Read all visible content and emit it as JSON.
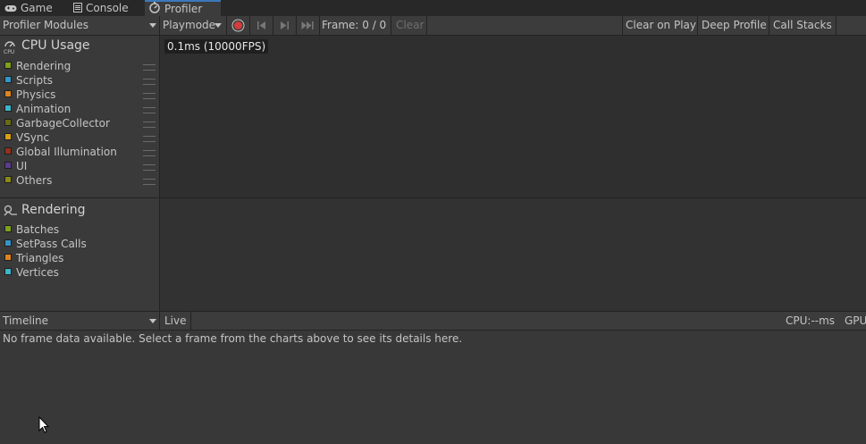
{
  "tabs": [
    {
      "label": "Game",
      "icon": "gamepad-icon"
    },
    {
      "label": "Console",
      "icon": "console-icon"
    },
    {
      "label": "Profiler",
      "icon": "profiler-icon",
      "active": true
    }
  ],
  "toolbar": {
    "modules_dropdown": "Profiler Modules",
    "playmode": "Playmode",
    "frame": "Frame: 0 / 0",
    "clear": "Clear",
    "clear_on_play": "Clear on Play",
    "deep_profile": "Deep Profile",
    "call_stacks": "Call Stacks"
  },
  "cpu_module": {
    "title": "CPU Usage",
    "items": [
      {
        "label": "Rendering",
        "color": "#7ea21a"
      },
      {
        "label": "Scripts",
        "color": "#3496c8"
      },
      {
        "label": "Physics",
        "color": "#e0831c"
      },
      {
        "label": "Animation",
        "color": "#3bb6c8"
      },
      {
        "label": "GarbageCollector",
        "color": "#6a6a14"
      },
      {
        "label": "VSync",
        "color": "#d8a014"
      },
      {
        "label": "Global Illumination",
        "color": "#96301c"
      },
      {
        "label": "UI",
        "color": "#5a3c8c"
      },
      {
        "label": "Others",
        "color": "#8a8a14"
      }
    ],
    "tooltip": "0.1ms (10000FPS)"
  },
  "rendering_module": {
    "title": "Rendering",
    "items": [
      {
        "label": "Batches",
        "color": "#7ea21a"
      },
      {
        "label": "SetPass Calls",
        "color": "#3496c8"
      },
      {
        "label": "Triangles",
        "color": "#e0831c"
      },
      {
        "label": "Vertices",
        "color": "#3bb6c8"
      }
    ]
  },
  "details": {
    "view_dropdown": "Timeline",
    "live": "Live",
    "cpu": "CPU:--ms",
    "gpu": "GPU",
    "message": "No frame data available. Select a frame from the charts above to see its details here."
  },
  "colors": {
    "record": "#d23c3c",
    "accent": "#3a79bb"
  }
}
